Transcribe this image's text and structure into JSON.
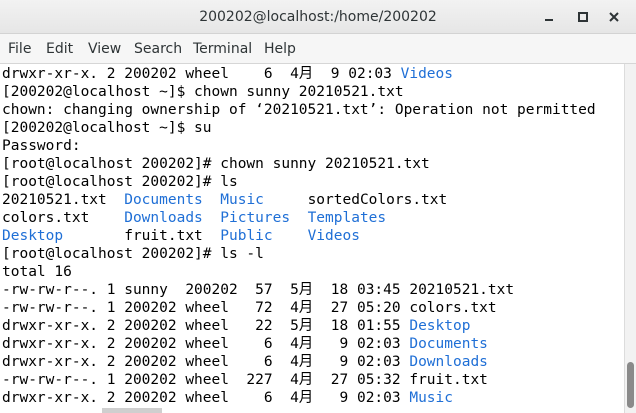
{
  "window": {
    "title": "200202@localhost:/home/200202",
    "buttons": {
      "minimize": "minimize-icon",
      "maximize": "maximize-icon",
      "close": "close-icon"
    }
  },
  "menu": [
    "File",
    "Edit",
    "View",
    "Search",
    "Terminal",
    "Help"
  ],
  "colors": {
    "directory": "#1f6fd6",
    "text": "#000000",
    "background": "#ffffff"
  },
  "terminal": {
    "lines": [
      [
        {
          "t": "drwxr-xr-x. 2 200202 wheel    6  4月  9 02:03 "
        },
        {
          "t": "Videos",
          "dir": true
        }
      ],
      [
        {
          "t": "[200202@localhost ~]$ chown sunny 20210521.txt"
        }
      ],
      [
        {
          "t": "chown: changing ownership of ‘20210521.txt’: Operation not permitted"
        }
      ],
      [
        {
          "t": "[200202@localhost ~]$ su"
        }
      ],
      [
        {
          "t": "Password:"
        }
      ],
      [
        {
          "t": "[root@localhost 200202]# chown sunny 20210521.txt"
        }
      ],
      [
        {
          "t": "[root@localhost 200202]# ls"
        }
      ],
      [
        {
          "t": "20210521.txt  "
        },
        {
          "t": "Documents",
          "dir": true
        },
        {
          "t": "  "
        },
        {
          "t": "Music",
          "dir": true
        },
        {
          "t": "     sortedColors.txt"
        }
      ],
      [
        {
          "t": "colors.txt    "
        },
        {
          "t": "Downloads",
          "dir": true
        },
        {
          "t": "  "
        },
        {
          "t": "Pictures",
          "dir": true
        },
        {
          "t": "  "
        },
        {
          "t": "Templates",
          "dir": true
        }
      ],
      [
        {
          "t": "Desktop",
          "dir": true
        },
        {
          "t": "       fruit.txt  "
        },
        {
          "t": "Public",
          "dir": true
        },
        {
          "t": "    "
        },
        {
          "t": "Videos",
          "dir": true
        }
      ],
      [
        {
          "t": "[root@localhost 200202]# ls -l"
        }
      ],
      [
        {
          "t": "total 16"
        }
      ],
      [
        {
          "t": "-rw-rw-r--. 1 sunny  200202  57  5月  18 03:45 20210521.txt"
        }
      ],
      [
        {
          "t": "-rw-rw-r--. 1 200202 wheel   72  4月  27 05:20 colors.txt"
        }
      ],
      [
        {
          "t": "drwxr-xr-x. 2 200202 wheel   22  5月  18 01:55 "
        },
        {
          "t": "Desktop",
          "dir": true
        }
      ],
      [
        {
          "t": "drwxr-xr-x. 2 200202 wheel    6  4月   9 02:03 "
        },
        {
          "t": "Documents",
          "dir": true
        }
      ],
      [
        {
          "t": "drwxr-xr-x. 2 200202 wheel    6  4月   9 02:03 "
        },
        {
          "t": "Downloads",
          "dir": true
        }
      ],
      [
        {
          "t": "-rw-rw-r--. 1 200202 wheel  227  4月  27 05:32 fruit.txt"
        }
      ],
      [
        {
          "t": "drwxr-xr-x. 2 200202 wheel    6  4月   9 02:03 "
        },
        {
          "t": "Music",
          "dir": true
        }
      ]
    ]
  }
}
